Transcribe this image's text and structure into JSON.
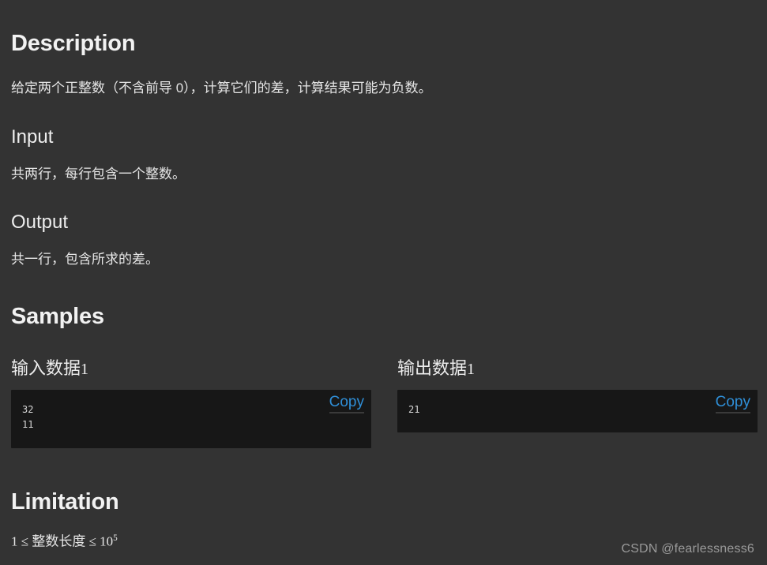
{
  "sections": {
    "description": {
      "heading": "Description",
      "body": "给定两个正整数（不含前导 0），计算它们的差，计算结果可能为负数。"
    },
    "input": {
      "heading": "Input",
      "body": "共两行，每行包含一个整数。"
    },
    "output": {
      "heading": "Output",
      "body": "共一行，包含所求的差。"
    },
    "samples": {
      "heading": "Samples",
      "items": [
        {
          "label_text": "输入数据",
          "label_index": "1",
          "code": "32\n11",
          "copy_label": "Copy"
        },
        {
          "label_text": "输出数据",
          "label_index": "1",
          "code": "21",
          "copy_label": "Copy"
        }
      ]
    },
    "limitation": {
      "heading": "Limitation",
      "formula_prefix": "1 ≤ 整数长度 ≤ 10",
      "formula_exponent": "5"
    }
  },
  "watermark": "CSDN @fearlessness6",
  "colors": {
    "page_background": "#333333",
    "code_background": "#171717",
    "text": "#e8e8e8",
    "link": "#2f8fd8",
    "watermark": "#9a9a9a"
  }
}
